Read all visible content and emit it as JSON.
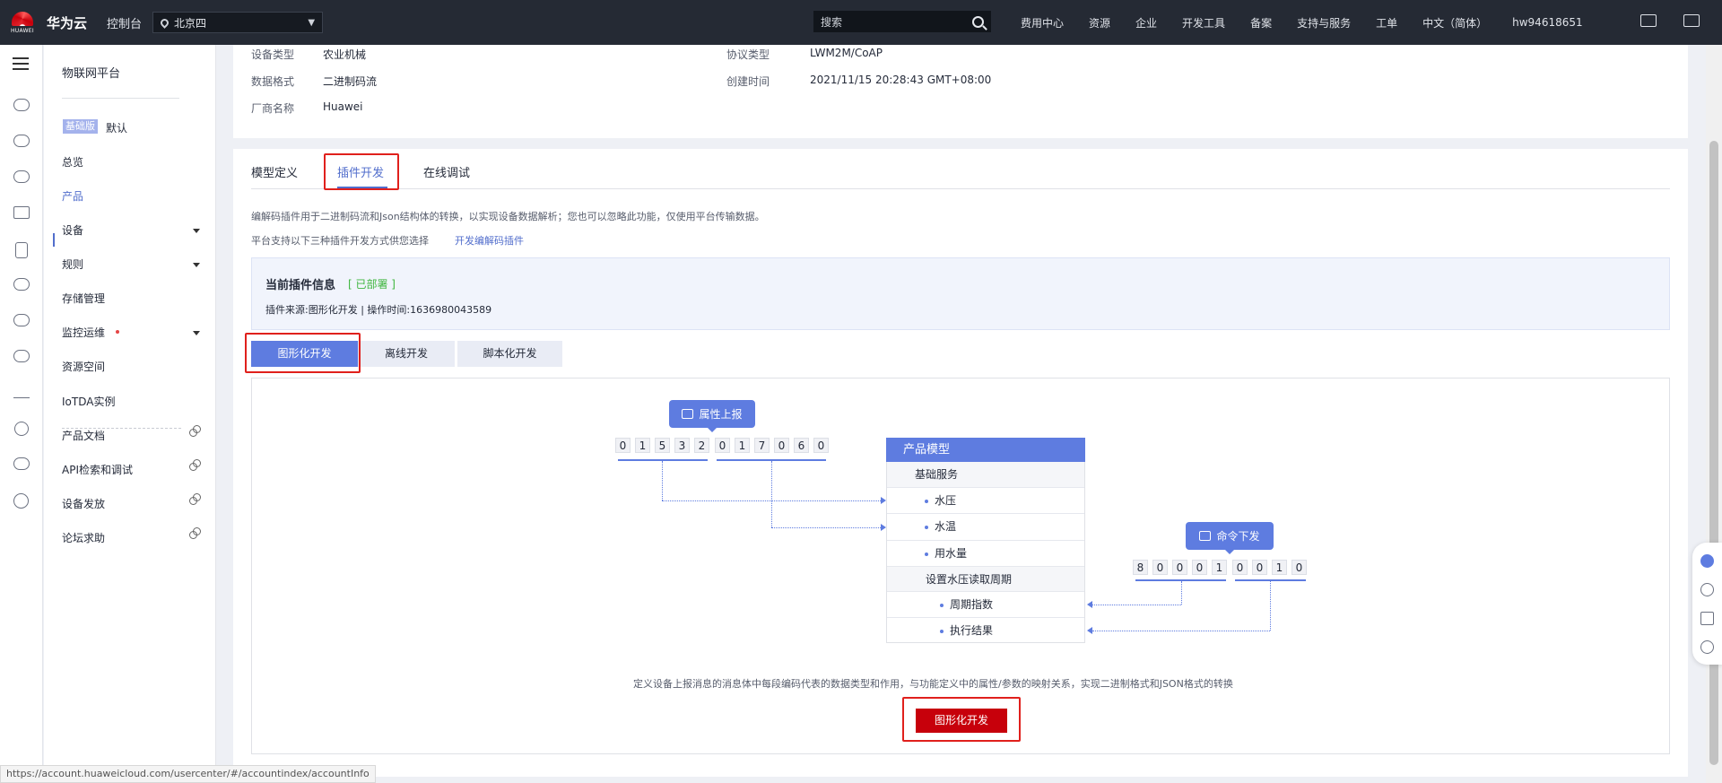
{
  "topbar": {
    "logo_word": "HUAWEI",
    "brand": "华为云",
    "console": "控制台",
    "region": "北京四",
    "search_placeholder": "搜索",
    "links": [
      "费用中心",
      "资源",
      "企业",
      "开发工具",
      "备案",
      "支持与服务",
      "工单",
      "中文（简体）",
      "hw94618651"
    ]
  },
  "sidemenu": {
    "title": "物联网平台",
    "edition_badge": "基础版",
    "edition_name": "默认",
    "items": [
      "总览",
      "产品",
      "设备",
      "规则",
      "存储管理",
      "监控运维",
      "资源空间",
      "IoTDA实例",
      "产品文档",
      "API检索和调试",
      "设备发放",
      "论坛求助"
    ]
  },
  "product_info": {
    "labels": [
      "设备类型",
      "数据格式",
      "厂商名称",
      "协议类型",
      "创建时间"
    ],
    "values": [
      "农业机械",
      "二进制码流",
      "Huawei",
      "LWM2M/CoAP",
      "2021/11/15 20:28:43 GMT+08:00"
    ]
  },
  "tabs": [
    "模型定义",
    "插件开发",
    "在线调试"
  ],
  "plugin": {
    "desc1": "编解码插件用于二进制码流和Json结构体的转换，以实现设备数据解析；您也可以忽略此功能，仅使用平台传输数据。",
    "desc2": "平台支持以下三种插件开发方式供您选择",
    "desc_link": "开发编解码插件",
    "current_title": "当前插件信息",
    "current_status": "[ 已部署 ]",
    "source_meta": "插件来源:图形化开发  |  操作时间:1636980043589",
    "dev_buttons": [
      "图形化开发",
      "离线开发",
      "脚本化开发"
    ]
  },
  "diagram": {
    "report_label": "属性上报",
    "report_digits": [
      "0",
      "1",
      "5",
      "3",
      "2",
      "0",
      "1",
      "7",
      "0",
      "6",
      "0"
    ],
    "model_title": "产品模型",
    "model_rows": [
      "基础服务",
      "水压",
      "水温",
      "用水量",
      "设置水压读取周期",
      "周期指数",
      "执行结果"
    ],
    "command_label": "命令下发",
    "command_digits": [
      "8",
      "0",
      "0",
      "0",
      "1",
      "0",
      "0",
      "1",
      "0"
    ],
    "footer": "定义设备上报消息的消息体中每段编码代表的数据类型和作用，与功能定义中的属性/参数的映射关系，实现二进制格式和JSON格式的转换",
    "cta": "图形化开发"
  },
  "statusbar_url": "https://account.huaweicloud.com/usercenter/#/accountindex/accountInfo",
  "colors": {
    "accent": "#5e7ce0",
    "cta": "#c7000b",
    "highlight": "#e0201c",
    "deployed": "#3fb63f"
  }
}
